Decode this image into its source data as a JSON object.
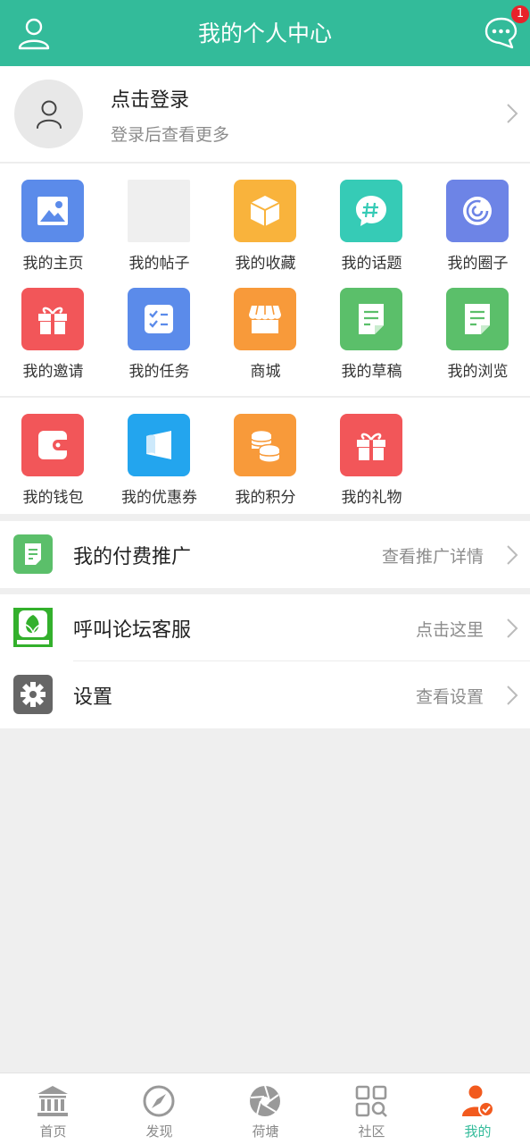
{
  "header": {
    "title": "我的个人中心",
    "message_badge": "1",
    "accent_color": "#33bb9a",
    "left_icon": "user-icon",
    "right_icon": "chat-bubble-icon"
  },
  "profile": {
    "title": "点击登录",
    "subtitle": "登录后查看更多"
  },
  "grid1": [
    {
      "label": "我的主页",
      "icon": "image-icon",
      "color": "#5b8bea"
    },
    {
      "label": "我的帖子",
      "icon": "blank-placeholder",
      "color": "#efefef"
    },
    {
      "label": "我的收藏",
      "icon": "box-icon",
      "color": "#f9b33c"
    },
    {
      "label": "我的话题",
      "icon": "hashtag-bubble-icon",
      "color": "#36cbb6"
    },
    {
      "label": "我的圈子",
      "icon": "circle-swirl-icon",
      "color": "#6d84e6"
    },
    {
      "label": "我的邀请",
      "icon": "gift-icon",
      "color": "#f25659"
    },
    {
      "label": "我的任务",
      "icon": "checklist-icon",
      "color": "#5b8bea"
    },
    {
      "label": "商城",
      "icon": "store-icon",
      "color": "#f89a3a"
    },
    {
      "label": "我的草稿",
      "icon": "note-icon",
      "color": "#5bbf6a"
    },
    {
      "label": "我的浏览",
      "icon": "note-icon",
      "color": "#5bbf6a"
    }
  ],
  "grid2": [
    {
      "label": "我的钱包",
      "icon": "wallet-icon",
      "color": "#f25659"
    },
    {
      "label": "我的优惠券",
      "icon": "coupon-icon",
      "color": "#23a5ee"
    },
    {
      "label": "我的积分",
      "icon": "coins-icon",
      "color": "#f89a3a"
    },
    {
      "label": "我的礼物",
      "icon": "gift-icon",
      "color": "#f25659"
    }
  ],
  "rows": {
    "promo": {
      "label": "我的付费推广",
      "detail": "查看推广详情",
      "icon": "document-icon"
    },
    "service": {
      "label": "呼叫论坛客服",
      "detail": "点击这里",
      "icon": "forum-logo-icon"
    },
    "settings": {
      "label": "设置",
      "detail": "查看设置",
      "icon": "gear-icon"
    }
  },
  "tabs": [
    {
      "label": "首页",
      "icon": "bank-icon",
      "active": false
    },
    {
      "label": "发现",
      "icon": "compass-icon",
      "active": false
    },
    {
      "label": "荷塘",
      "icon": "aperture-icon",
      "active": false
    },
    {
      "label": "社区",
      "icon": "grid-search-icon",
      "active": false
    },
    {
      "label": "我的",
      "icon": "person-check-icon",
      "active": true
    }
  ]
}
